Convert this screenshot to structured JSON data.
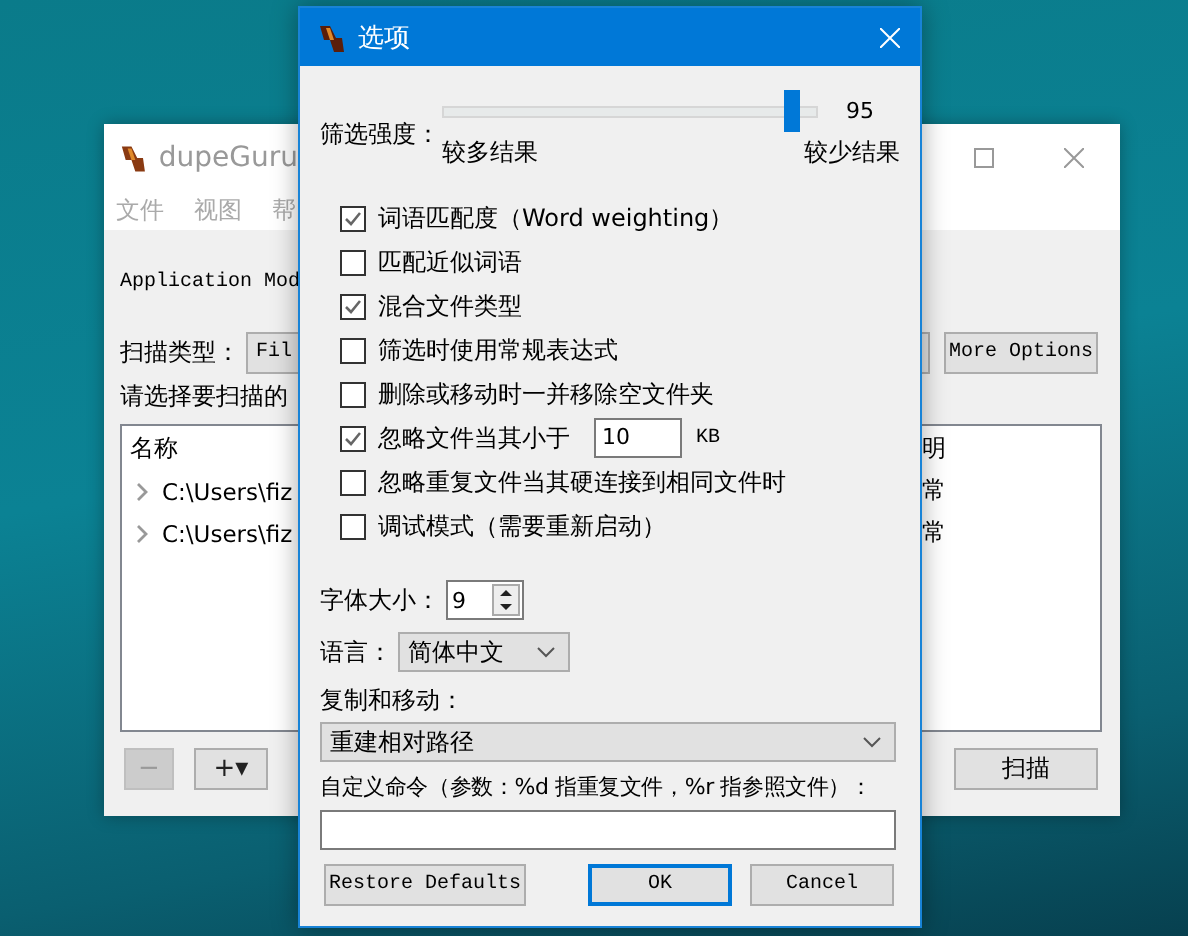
{
  "main_window": {
    "title": "dupeGuru",
    "menu": [
      "文件",
      "视图",
      "帮"
    ],
    "app_mode": "Application Mod",
    "scan_type": {
      "label": "扫描类型：",
      "value": "Fil"
    },
    "more_options": "More Options",
    "folders_label": "请选择要扫描的",
    "folders": {
      "columns": [
        "名称",
        "明"
      ],
      "rows": [
        {
          "path": "C:\\Users\\fiz",
          "state": "常"
        },
        {
          "path": "C:\\Users\\fiz",
          "state": "常"
        }
      ]
    },
    "buttons": [
      {
        "label": "−",
        "disabled": true
      },
      {
        "label": "+▾",
        "disabled": false
      }
    ],
    "scan_button": "扫描"
  },
  "dialog": {
    "title": "选项",
    "threshold": {
      "label": "筛选强度：",
      "level": 0.95,
      "reading": "95",
      "min_label": "较多结果",
      "max_label": "较少结果"
    },
    "options": [
      {
        "label": "词语匹配度（Word weighting）",
        "checked": true
      },
      {
        "label": "匹配近似词语",
        "checked": false
      },
      {
        "label": "混合文件类型",
        "checked": true
      },
      {
        "label": "筛选时使用常规表达式",
        "checked": false
      },
      {
        "label": "删除或移动时一并移除空文件夹",
        "checked": false
      },
      {
        "label": "忽略文件当其小于",
        "checked": true,
        "value": "10",
        "unit": "KB"
      },
      {
        "label": "忽略重复文件当其硬连接到相同文件时",
        "checked": false
      },
      {
        "label": "调试模式（需要重新启动）",
        "checked": false
      }
    ],
    "font_size": {
      "label": "字体大小：",
      "value": "9"
    },
    "language": {
      "label": "语言：",
      "value": "简体中文"
    },
    "copy_move": {
      "label": "复制和移动：",
      "value": "重建相对路径"
    },
    "custom_command": {
      "label": "自定义命令（参数：%d 指重复文件，%r 指参照文件）："
    },
    "buttons": [
      {
        "label": "Restore Defaults",
        "kind": "normal"
      },
      {
        "label": "OK",
        "kind": "default"
      },
      {
        "label": "Cancel",
        "kind": "normal"
      }
    ]
  }
}
